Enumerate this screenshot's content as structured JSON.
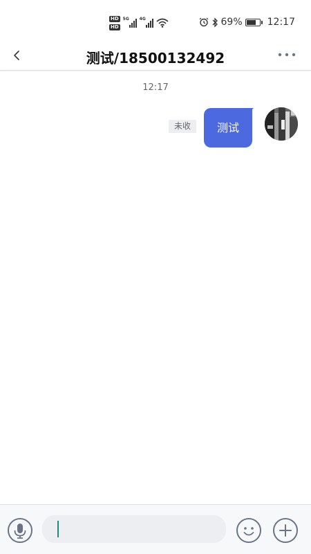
{
  "status_bar": {
    "hd_top": "HD",
    "hd_bottom": "HD",
    "net_1": "5G",
    "net_2": "4G",
    "battery_percent_text": "69%",
    "battery_level": 0.69,
    "time": "12:17",
    "icons": [
      "signal-5g-icon",
      "signal-4g-icon",
      "wifi-icon",
      "alarm-icon",
      "bluetooth-icon",
      "battery-icon"
    ]
  },
  "header": {
    "title": "测试/18500132492",
    "back_icon": "chevron-left-icon",
    "more_icon": "more-dots-icon"
  },
  "chat": {
    "timestamp": "12:17",
    "messages": [
      {
        "text": "测试",
        "status": "未收",
        "direction": "outgoing"
      }
    ]
  },
  "input_bar": {
    "voice_icon": "microphone-icon",
    "text_value": "",
    "emoji_icon": "smiley-icon",
    "plus_icon": "plus-circle-icon"
  },
  "colors": {
    "bubble": "#4d69e0",
    "caret": "#1d8a7a",
    "icon_gray": "#6b7487"
  }
}
